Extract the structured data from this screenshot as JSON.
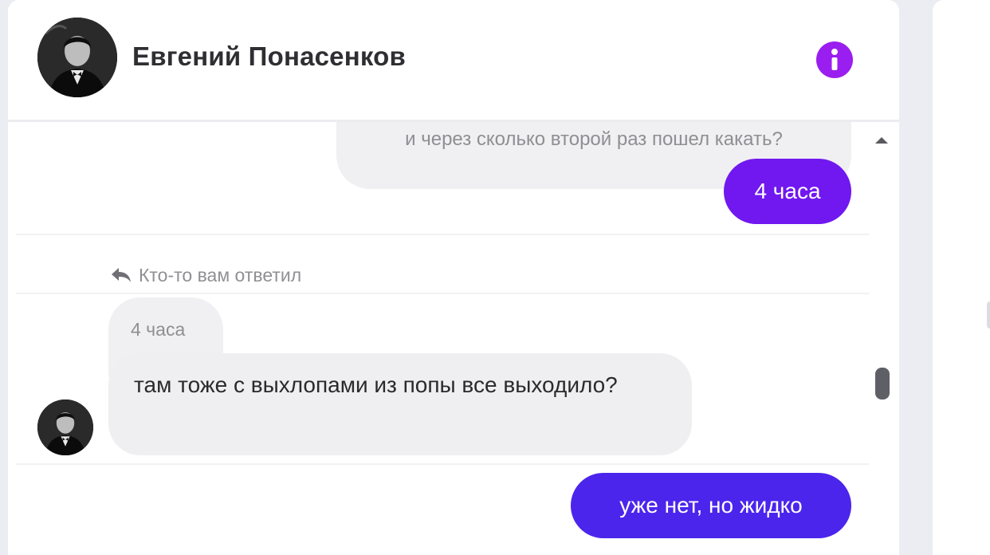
{
  "chat": {
    "contact_name": "Евгений Понасенков",
    "info_icon": "info-icon",
    "accent_color": "#9a1ef0"
  },
  "messages": {
    "quoted_outgoing_text": "и через сколько второй раз пошел какать?",
    "outgoing_1": "4 часа",
    "reply_notice": "Кто-то вам ответил",
    "quoted_incoming_text": "4 часа",
    "incoming_1": "там тоже с выхлопами из попы все выходило?",
    "outgoing_2": "уже нет, но жидко"
  },
  "colors": {
    "outgoing_bubble": "#7018ef",
    "outgoing_bubble_2": "#4b25ec",
    "incoming_bubble": "#efeff1"
  }
}
